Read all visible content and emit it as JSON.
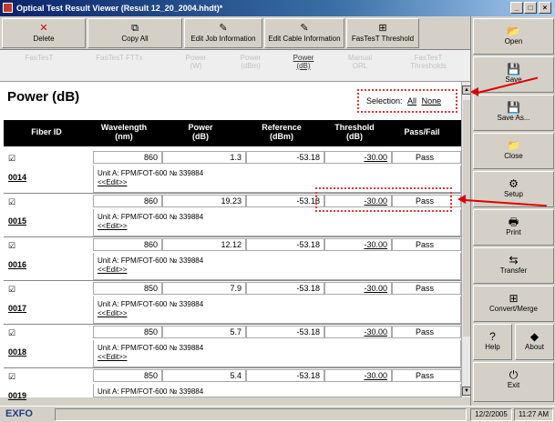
{
  "window": {
    "title": "Optical Test Result Viewer (Result 12_20_2004.hhdt)*",
    "minimize": "_",
    "maximize": "□",
    "close": "×"
  },
  "toolbar": {
    "delete": "Delete",
    "copy_all": "Copy All",
    "edit_job": "Edit Job Information",
    "edit_cable": "Edit Cable Information",
    "fastest_threshold": "FasTesT Threshold"
  },
  "tabs": [
    {
      "label": "FasTesT",
      "active": false
    },
    {
      "label": "FasTesT FTTx",
      "active": false
    },
    {
      "label": "Power\n(W)",
      "active": false
    },
    {
      "label": "Power\n(dBm)",
      "active": false
    },
    {
      "label": "Power\n(dB)",
      "active": true
    },
    {
      "label": "Manual\nORL",
      "active": false
    },
    {
      "label": "FasTesT\nThresholds",
      "active": false
    }
  ],
  "page": {
    "title": "Power (dB)"
  },
  "selection": {
    "label": "Selection:",
    "all": "All",
    "none": "None"
  },
  "table": {
    "headers": [
      "Fiber ID",
      "Wavelength\n(nm)",
      "Power\n(dB)",
      "Reference\n(dBm)",
      "Threshold\n(dB)",
      "Pass/Fail"
    ],
    "rows": [
      {
        "checked": "☑",
        "fiber_id": "0014",
        "wavelength": "860",
        "power": "1.3",
        "reference": "-53.18",
        "threshold": "-30.00",
        "result": "Pass",
        "unit": "Unit A: FPM/FOT-600 № 339884",
        "edit": "<<Edit>>"
      },
      {
        "checked": "☑",
        "fiber_id": "0015",
        "wavelength": "860",
        "power": "19.23",
        "reference": "-53.18",
        "threshold": "-30.00",
        "result": "Pass",
        "unit": "Unit A: FPM/FOT-600 № 339884",
        "edit": "<<Edit>>"
      },
      {
        "checked": "☑",
        "fiber_id": "0016",
        "wavelength": "860",
        "power": "12.12",
        "reference": "-53.18",
        "threshold": "-30.00",
        "result": "Pass",
        "unit": "Unit A: FPM/FOT-600 № 339884",
        "edit": "<<Edit>>"
      },
      {
        "checked": "☑",
        "fiber_id": "0017",
        "wavelength": "850",
        "power": "7.9",
        "reference": "-53.18",
        "threshold": "-30.00",
        "result": "Pass",
        "unit": "Unit A: FPM/FOT-600 № 339884",
        "edit": "<<Edit>>"
      },
      {
        "checked": "☑",
        "fiber_id": "0018",
        "wavelength": "850",
        "power": "5.7",
        "reference": "-53.18",
        "threshold": "-30.00",
        "result": "Pass",
        "unit": "Unit A: FPM/FOT-600 № 339884",
        "edit": "<<Edit>>"
      },
      {
        "checked": "☑",
        "fiber_id": "0019",
        "wavelength": "850",
        "power": "5.4",
        "reference": "-53.18",
        "threshold": "-30.00",
        "result": "Pass",
        "unit": "Unit A: FPM/FOT-600 № 339884",
        "edit": ""
      }
    ]
  },
  "sidebar": {
    "open": "Open",
    "save": "Save",
    "save_as": "Save As...",
    "close": "Close",
    "setup": "Setup",
    "print": "Print",
    "transfer": "Transfer",
    "convert_merge": "Convert/Merge",
    "help": "Help",
    "about": "About",
    "exit": "Exit"
  },
  "status": {
    "brand": "EXFO",
    "date": "12/2/2005",
    "time": "11:27 AM"
  },
  "colors": {
    "titlebar": "#0a246a",
    "annotation": "#d00000",
    "header_bg": "#000000"
  }
}
